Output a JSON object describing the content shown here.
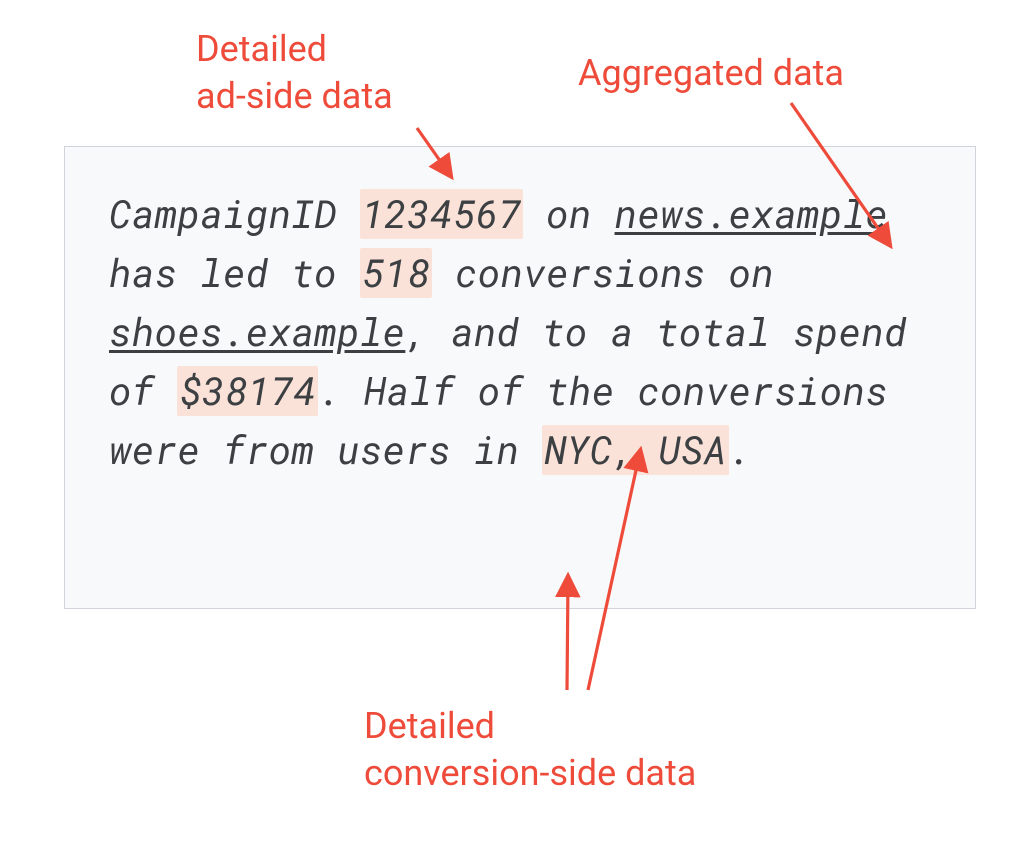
{
  "annotations": {
    "ad_side": "Detailed\nad-side data",
    "aggregated": "Aggregated data",
    "conv_side": "Detailed\nconversion-side data"
  },
  "body": {
    "t1": "CampaignID ",
    "campaign_id": "1234567",
    "t2": " on ",
    "site1": "news.example",
    "t3": " has led to ",
    "conversions": "518",
    "t4": " conversions on ",
    "site2": "shoes.example",
    "t5": ", and to a total spend of ",
    "spend": "$38174",
    "t6": ". Half of the conversions were from users in ",
    "location": "NYC, USA",
    "t7": "."
  },
  "colors": {
    "accent": "#ee4b3a",
    "highlight": "#fbe2d9",
    "box_bg": "#f8f9fa",
    "box_border": "#d1d5db",
    "text": "#3c4043"
  }
}
